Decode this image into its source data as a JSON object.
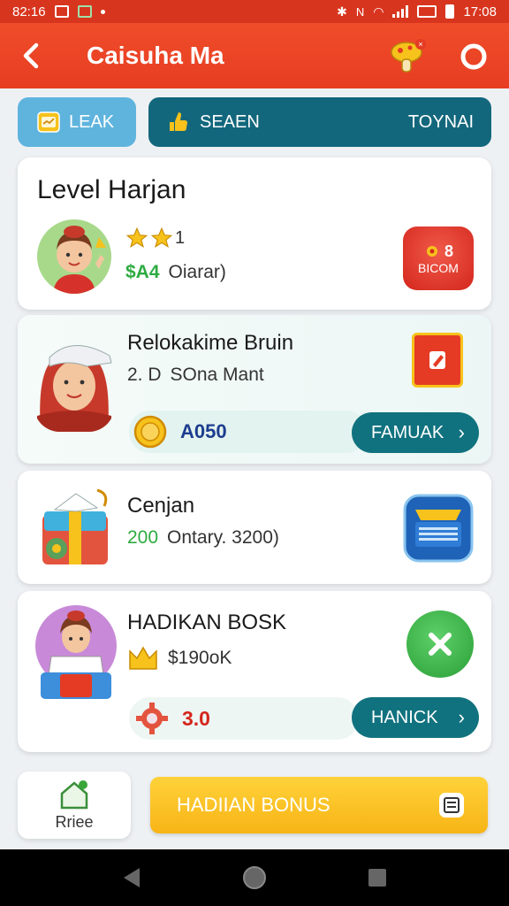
{
  "status_bar": {
    "time_left": "82:16",
    "time_right": "17:08"
  },
  "app_bar": {
    "title": "Caisuha Ma"
  },
  "tabs": {
    "leak": {
      "label": "LEAK"
    },
    "season": {
      "label": "SEAEN",
      "right_label": "TOYNAI"
    }
  },
  "cards": [
    {
      "title": "Level Harjan",
      "stars_suffix": "1",
      "value_green": "$A4",
      "value_text": "Oiarar)",
      "badge_text": "BICOM",
      "badge_top": "8"
    },
    {
      "title": "Relokakime Bruin",
      "sub_num": "2. D",
      "sub_text": "SOna Mant",
      "coin_value": "A050",
      "button_label": "FAMUAK"
    },
    {
      "title": "Cenjan",
      "sub_green": "200",
      "sub_text": "Ontary. 3200)"
    },
    {
      "title": "HADIKAN BOSK",
      "sub_text": "$190oK",
      "red_value": "3.0",
      "button_label": "HANICK"
    }
  ],
  "bottom": {
    "left_label": "Rriee",
    "bonus_label": "HADIIAN BONUS"
  },
  "colors": {
    "accent_red": "#e73d22",
    "teal": "#11727f",
    "light_blue": "#5fb4de",
    "yellow": "#f7b416",
    "green": "#2dab40"
  }
}
